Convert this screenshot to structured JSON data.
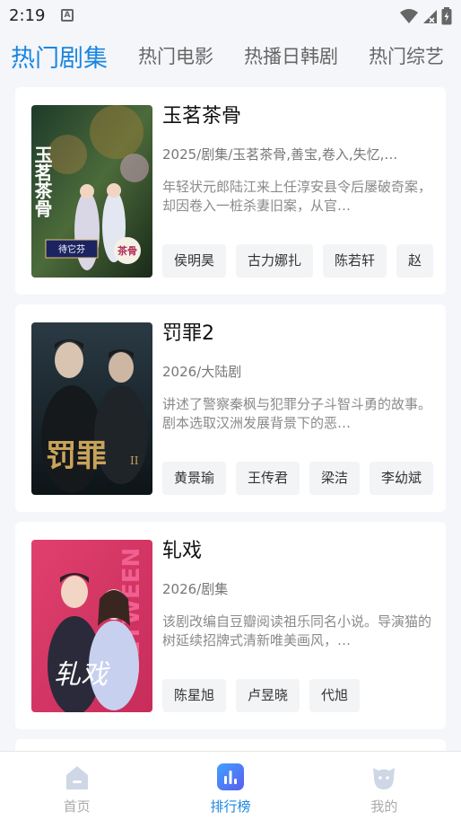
{
  "status": {
    "time": "2:19",
    "notif_glyph": "A"
  },
  "tabs": [
    "热门剧集",
    "热门电影",
    "热播日韩剧",
    "热门综艺"
  ],
  "cards": [
    {
      "title": "玉茗茶骨",
      "meta": "2025/剧集/玉茗茶骨,善宝,卷入,失忆,…",
      "desc": "年轻状元郎陆江来上任淳安县令后屡破奇案，却因卷入一桩杀妻旧案，从官…",
      "tags": [
        "侯明昊",
        "古力娜扎",
        "陈若轩",
        "赵"
      ],
      "poster": {
        "text": "玉茗茶骨",
        "badge_left": "待它芬",
        "badge_right": "茶骨"
      }
    },
    {
      "title": "罚罪2",
      "meta": "2026/大陆剧",
      "desc": "讲述了警察秦枫与犯罪分子斗智斗勇的故事。剧本选取汉洲发展背景下的恶…",
      "tags": [
        "黄景瑜",
        "王传君",
        "梁洁",
        "李幼斌"
      ],
      "poster": {
        "text": "罚罪",
        "suffix": "II"
      }
    },
    {
      "title": "轧戏",
      "meta": "2026/剧集",
      "desc": "该剧改编自豆瓣阅读祖乐同名小说。导演猫的树延续招牌式清新唯美画风，…",
      "tags": [
        "陈星旭",
        "卢昱晓",
        "代旭"
      ],
      "poster": {
        "text": "轧戏",
        "bg_text": "BETWEEN"
      }
    }
  ],
  "nav": [
    "首页",
    "排行榜",
    "我的"
  ]
}
